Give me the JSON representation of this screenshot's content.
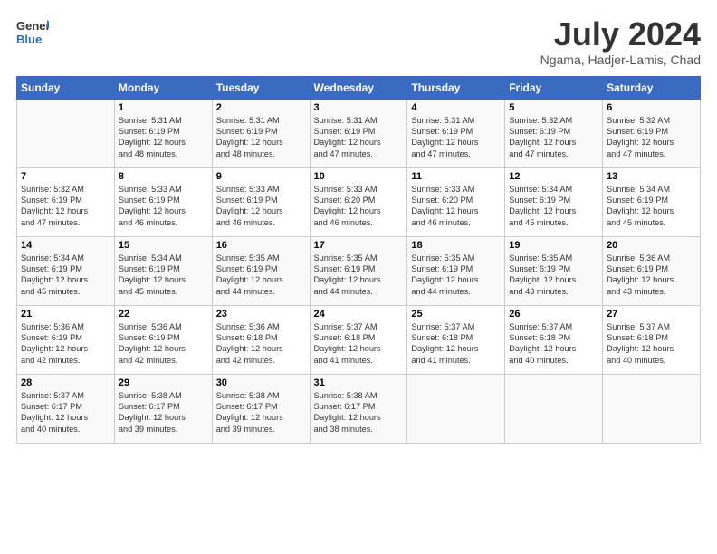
{
  "header": {
    "logo_line1": "General",
    "logo_line2": "Blue",
    "month": "July 2024",
    "location": "Ngama, Hadjer-Lamis, Chad"
  },
  "days_of_week": [
    "Sunday",
    "Monday",
    "Tuesday",
    "Wednesday",
    "Thursday",
    "Friday",
    "Saturday"
  ],
  "weeks": [
    [
      {
        "day": "",
        "info": ""
      },
      {
        "day": "1",
        "info": "Sunrise: 5:31 AM\nSunset: 6:19 PM\nDaylight: 12 hours\nand 48 minutes."
      },
      {
        "day": "2",
        "info": "Sunrise: 5:31 AM\nSunset: 6:19 PM\nDaylight: 12 hours\nand 48 minutes."
      },
      {
        "day": "3",
        "info": "Sunrise: 5:31 AM\nSunset: 6:19 PM\nDaylight: 12 hours\nand 47 minutes."
      },
      {
        "day": "4",
        "info": "Sunrise: 5:31 AM\nSunset: 6:19 PM\nDaylight: 12 hours\nand 47 minutes."
      },
      {
        "day": "5",
        "info": "Sunrise: 5:32 AM\nSunset: 6:19 PM\nDaylight: 12 hours\nand 47 minutes."
      },
      {
        "day": "6",
        "info": "Sunrise: 5:32 AM\nSunset: 6:19 PM\nDaylight: 12 hours\nand 47 minutes."
      }
    ],
    [
      {
        "day": "7",
        "info": "Sunrise: 5:32 AM\nSunset: 6:19 PM\nDaylight: 12 hours\nand 47 minutes."
      },
      {
        "day": "8",
        "info": "Sunrise: 5:33 AM\nSunset: 6:19 PM\nDaylight: 12 hours\nand 46 minutes."
      },
      {
        "day": "9",
        "info": "Sunrise: 5:33 AM\nSunset: 6:19 PM\nDaylight: 12 hours\nand 46 minutes."
      },
      {
        "day": "10",
        "info": "Sunrise: 5:33 AM\nSunset: 6:20 PM\nDaylight: 12 hours\nand 46 minutes."
      },
      {
        "day": "11",
        "info": "Sunrise: 5:33 AM\nSunset: 6:20 PM\nDaylight: 12 hours\nand 46 minutes."
      },
      {
        "day": "12",
        "info": "Sunrise: 5:34 AM\nSunset: 6:19 PM\nDaylight: 12 hours\nand 45 minutes."
      },
      {
        "day": "13",
        "info": "Sunrise: 5:34 AM\nSunset: 6:19 PM\nDaylight: 12 hours\nand 45 minutes."
      }
    ],
    [
      {
        "day": "14",
        "info": "Sunrise: 5:34 AM\nSunset: 6:19 PM\nDaylight: 12 hours\nand 45 minutes."
      },
      {
        "day": "15",
        "info": "Sunrise: 5:34 AM\nSunset: 6:19 PM\nDaylight: 12 hours\nand 45 minutes."
      },
      {
        "day": "16",
        "info": "Sunrise: 5:35 AM\nSunset: 6:19 PM\nDaylight: 12 hours\nand 44 minutes."
      },
      {
        "day": "17",
        "info": "Sunrise: 5:35 AM\nSunset: 6:19 PM\nDaylight: 12 hours\nand 44 minutes."
      },
      {
        "day": "18",
        "info": "Sunrise: 5:35 AM\nSunset: 6:19 PM\nDaylight: 12 hours\nand 44 minutes."
      },
      {
        "day": "19",
        "info": "Sunrise: 5:35 AM\nSunset: 6:19 PM\nDaylight: 12 hours\nand 43 minutes."
      },
      {
        "day": "20",
        "info": "Sunrise: 5:36 AM\nSunset: 6:19 PM\nDaylight: 12 hours\nand 43 minutes."
      }
    ],
    [
      {
        "day": "21",
        "info": "Sunrise: 5:36 AM\nSunset: 6:19 PM\nDaylight: 12 hours\nand 42 minutes."
      },
      {
        "day": "22",
        "info": "Sunrise: 5:36 AM\nSunset: 6:19 PM\nDaylight: 12 hours\nand 42 minutes."
      },
      {
        "day": "23",
        "info": "Sunrise: 5:36 AM\nSunset: 6:18 PM\nDaylight: 12 hours\nand 42 minutes."
      },
      {
        "day": "24",
        "info": "Sunrise: 5:37 AM\nSunset: 6:18 PM\nDaylight: 12 hours\nand 41 minutes."
      },
      {
        "day": "25",
        "info": "Sunrise: 5:37 AM\nSunset: 6:18 PM\nDaylight: 12 hours\nand 41 minutes."
      },
      {
        "day": "26",
        "info": "Sunrise: 5:37 AM\nSunset: 6:18 PM\nDaylight: 12 hours\nand 40 minutes."
      },
      {
        "day": "27",
        "info": "Sunrise: 5:37 AM\nSunset: 6:18 PM\nDaylight: 12 hours\nand 40 minutes."
      }
    ],
    [
      {
        "day": "28",
        "info": "Sunrise: 5:37 AM\nSunset: 6:17 PM\nDaylight: 12 hours\nand 40 minutes."
      },
      {
        "day": "29",
        "info": "Sunrise: 5:38 AM\nSunset: 6:17 PM\nDaylight: 12 hours\nand 39 minutes."
      },
      {
        "day": "30",
        "info": "Sunrise: 5:38 AM\nSunset: 6:17 PM\nDaylight: 12 hours\nand 39 minutes."
      },
      {
        "day": "31",
        "info": "Sunrise: 5:38 AM\nSunset: 6:17 PM\nDaylight: 12 hours\nand 38 minutes."
      },
      {
        "day": "",
        "info": ""
      },
      {
        "day": "",
        "info": ""
      },
      {
        "day": "",
        "info": ""
      }
    ]
  ]
}
